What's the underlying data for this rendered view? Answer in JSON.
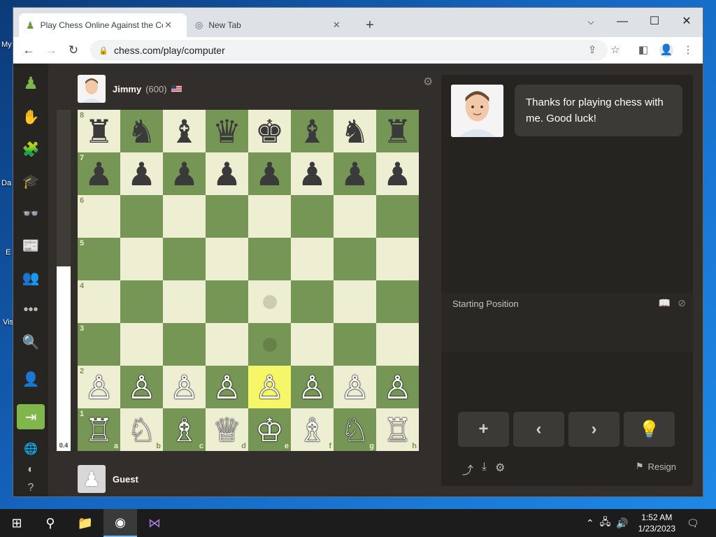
{
  "desktop": {
    "labels": [
      "My",
      "Da",
      "E",
      "Vis"
    ]
  },
  "browser": {
    "tabs": [
      {
        "title": "Play Chess Online Against the Computer",
        "icon": "chess-pawn-favicon",
        "active": true
      },
      {
        "title": "New Tab",
        "icon": "chrome-favicon",
        "active": false
      }
    ],
    "url": "chess.com/play/computer"
  },
  "app": {
    "opponent": {
      "name": "Jimmy",
      "rating": "(600)",
      "flag": "us-flag"
    },
    "player": {
      "name": "Guest"
    },
    "eval": {
      "value": "0.4",
      "white_fraction": 0.54
    },
    "board": {
      "ranks": [
        "8",
        "7",
        "6",
        "5",
        "4",
        "3",
        "2",
        "1"
      ],
      "files": [
        "a",
        "b",
        "c",
        "d",
        "e",
        "f",
        "g",
        "h"
      ],
      "position": [
        [
          "♜",
          "♞",
          "♝",
          "♛",
          "♚",
          "♝",
          "♞",
          "♜"
        ],
        [
          "♟",
          "♟",
          "♟",
          "♟",
          "♟",
          "♟",
          "♟",
          "♟"
        ],
        [
          "",
          "",
          "",
          "",
          "",
          "",
          "",
          ""
        ],
        [
          "",
          "",
          "",
          "",
          "",
          "",
          "",
          ""
        ],
        [
          "",
          "",
          "",
          "",
          "",
          "",
          "",
          ""
        ],
        [
          "",
          "",
          "",
          "",
          "",
          "",
          "",
          ""
        ],
        [
          "♙",
          "♙",
          "♙",
          "♙",
          "♙",
          "♙",
          "♙",
          "♙"
        ],
        [
          "♖",
          "♘",
          "♗",
          "♕",
          "♔",
          "♗",
          "♘",
          "♖"
        ]
      ],
      "highlight": "e2",
      "move_hints": [
        "e4",
        "e3"
      ]
    },
    "coach_message": "Thanks for playing chess with me. Good luck!",
    "moves_header": "Starting Position",
    "controls": [
      {
        "label": "+",
        "name": "new-game-button"
      },
      {
        "label": "‹",
        "name": "previous-move-button"
      },
      {
        "label": "›",
        "name": "next-move-button"
      },
      {
        "label": "💡",
        "name": "hint-button"
      }
    ],
    "resign_label": "Resign"
  },
  "taskbar": {
    "time": "1:52 AM",
    "date": "1/23/2023"
  },
  "colors": {
    "light_square": "#eeeed2",
    "dark_square": "#769656",
    "highlight": "#f6f669"
  }
}
